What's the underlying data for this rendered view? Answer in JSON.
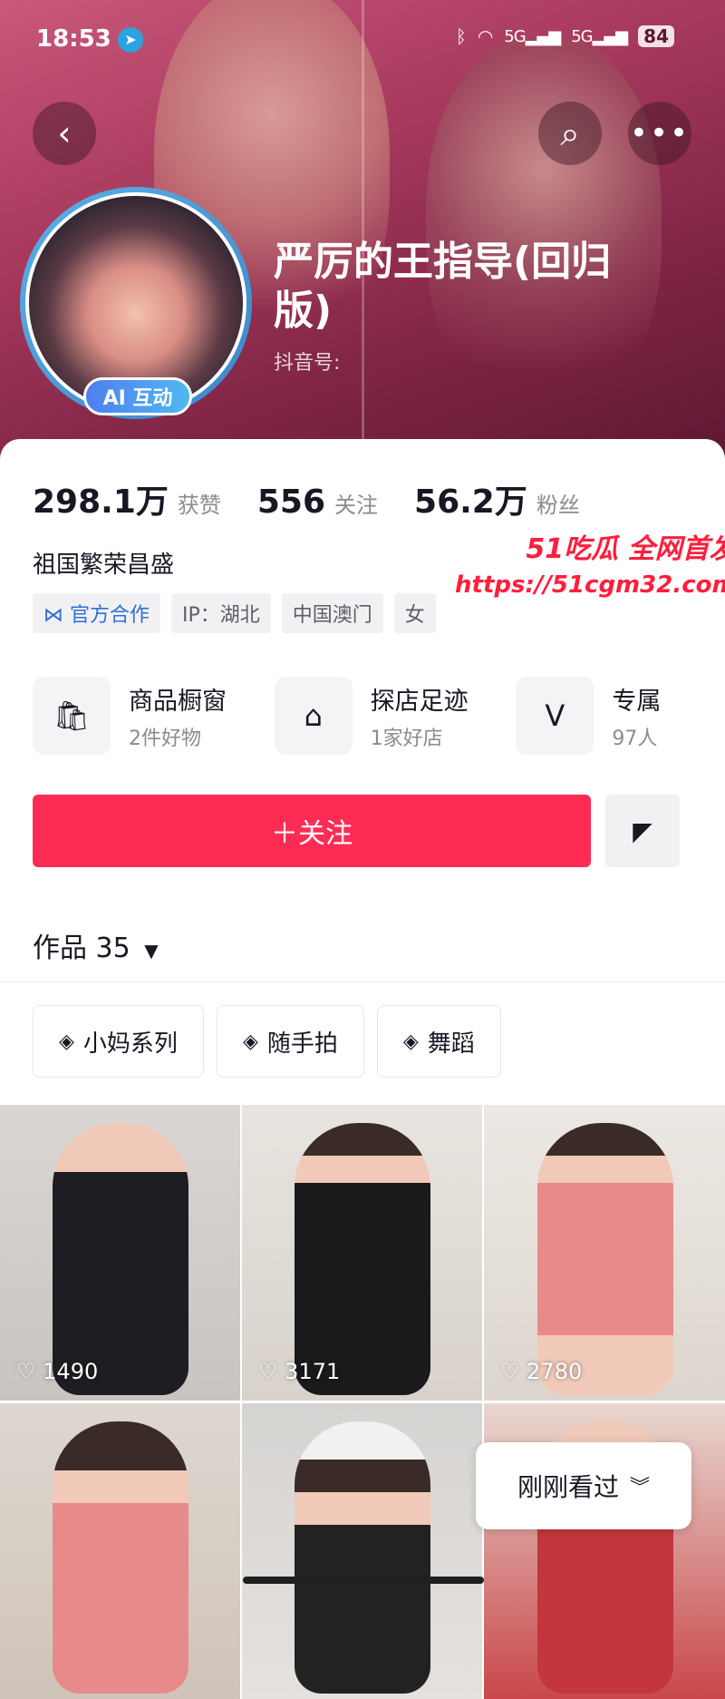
{
  "status_bar": {
    "time": "18:53",
    "battery": "84",
    "signal_1": "5G",
    "signal_2": "5G"
  },
  "profile": {
    "name": "严厉的王指导(回归版)",
    "douyin_id_label": "抖音号:",
    "ai_badge": "AI 互动",
    "stats": [
      {
        "value": "298.1万",
        "label": "获赞"
      },
      {
        "value": "556",
        "label": "关注"
      },
      {
        "value": "56.2万",
        "label": "粉丝"
      }
    ],
    "bio": "祖国繁荣昌盛",
    "tags": [
      "官方合作",
      "IP：湖北",
      "中国澳门",
      "女"
    ]
  },
  "shortcuts": [
    {
      "title": "商品橱窗",
      "sub": "2件好物"
    },
    {
      "title": "探店足迹",
      "sub": "1家好店"
    },
    {
      "title": "专属",
      "sub": "97人"
    }
  ],
  "actions": {
    "follow": "＋关注"
  },
  "works": {
    "label": "作品",
    "count": "35"
  },
  "collections": [
    "小妈系列",
    "随手拍",
    "舞蹈"
  ],
  "videos": [
    {
      "likes": "1490"
    },
    {
      "likes": "3171"
    },
    {
      "likes": "2780"
    },
    {
      "likes": ""
    },
    {
      "likes": ""
    },
    {
      "likes": ""
    }
  ],
  "recent_button": "刚刚看过",
  "watermark": {
    "line1": "51吃瓜 全网首发",
    "line2": "https://51cgm32.com"
  }
}
